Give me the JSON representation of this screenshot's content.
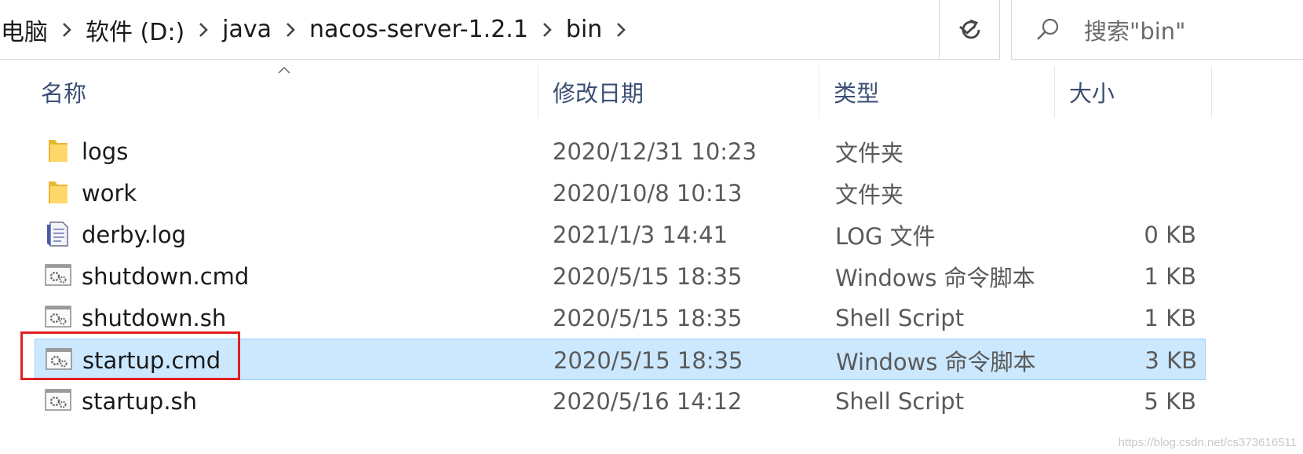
{
  "address_bar": {
    "crumbs": [
      "电脑",
      "软件 (D:)",
      "java",
      "nacos-server-1.2.1",
      "bin"
    ],
    "dropdown_icon": "chevron-down-icon",
    "refresh_icon": "refresh-icon"
  },
  "search": {
    "placeholder": "搜索\"bin\"",
    "icon": "search-icon"
  },
  "columns": {
    "name": "名称",
    "date": "修改日期",
    "type": "类型",
    "size": "大小"
  },
  "files": [
    {
      "name": "logs",
      "date": "2020/12/31 10:23",
      "type": "文件夹",
      "size": "",
      "icon": "folder-icon"
    },
    {
      "name": "work",
      "date": "2020/10/8 10:13",
      "type": "文件夹",
      "size": "",
      "icon": "folder-icon"
    },
    {
      "name": "derby.log",
      "date": "2021/1/3 14:41",
      "type": "LOG 文件",
      "size": "0 KB",
      "icon": "text-file-icon"
    },
    {
      "name": "shutdown.cmd",
      "date": "2020/5/15 18:35",
      "type": "Windows 命令脚本",
      "size": "1 KB",
      "icon": "script-file-icon"
    },
    {
      "name": "shutdown.sh",
      "date": "2020/5/15 18:35",
      "type": "Shell Script",
      "size": "1 KB",
      "icon": "script-file-icon"
    },
    {
      "name": "startup.cmd",
      "date": "2020/5/15 18:35",
      "type": "Windows 命令脚本",
      "size": "3 KB",
      "icon": "script-file-icon",
      "selected": true
    },
    {
      "name": "startup.sh",
      "date": "2020/5/16 14:12",
      "type": "Shell Script",
      "size": "5 KB",
      "icon": "script-file-icon"
    }
  ],
  "watermark": "https://blog.csdn.net/cs373616511",
  "colors": {
    "selection": "#cce8ff",
    "selection_border": "#99d1ff",
    "highlight_box": "#e02020",
    "header_text": "#3b4f73"
  }
}
